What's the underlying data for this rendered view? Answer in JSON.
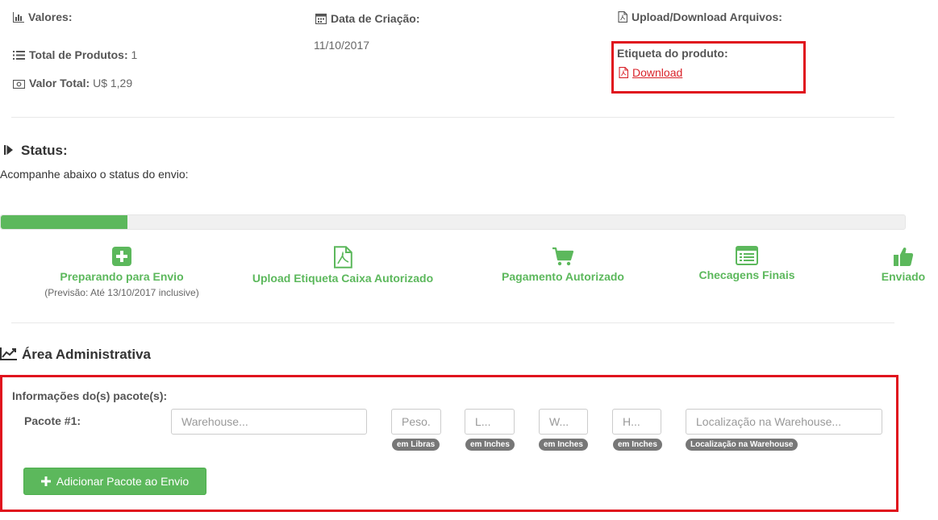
{
  "summary": {
    "values_label": "Valores:",
    "total_products_label": "Total de Produtos:",
    "total_products_value": "1",
    "total_value_label": "Valor Total:",
    "total_value_value": "U$ 1,29",
    "creation_date_label": "Data de Criação:",
    "creation_date_value": "11/10/2017",
    "upload_download_label": "Upload/Download Arquivos:",
    "product_label_title": "Etiqueta do produto:",
    "download_link": "Download"
  },
  "status": {
    "title": "Status:",
    "description": "Acompanhe abaixo o status do envio:",
    "progress": 0.14,
    "color": "#5cb85c",
    "steps": [
      {
        "label": "Preparando para Envio",
        "sub": "(Previsão: Até 13/10/2017 inclusive)",
        "icon": "plus-square-icon"
      },
      {
        "label": "Upload Etiqueta Caixa Autorizado",
        "icon": "pdf-file-icon"
      },
      {
        "label": "Pagamento Autorizado",
        "icon": "cart-icon"
      },
      {
        "label": "Checagens Finais",
        "icon": "list-icon"
      },
      {
        "label": "Enviado",
        "icon": "thumbs-up-icon"
      }
    ]
  },
  "admin": {
    "title": "Área Administrativa",
    "packages_title": "Informações do(s) pacote(s):",
    "package_label": "Pacote #1:",
    "fields": {
      "warehouse_placeholder": "Warehouse...",
      "weight_placeholder": "Peso.",
      "length_placeholder": "L...",
      "width_placeholder": "W...",
      "height_placeholder": "H...",
      "location_placeholder": "Localização na Warehouse..."
    },
    "badges": {
      "weight": "em Libras",
      "length": "em Inches",
      "width": "em Inches",
      "height": "em Inches",
      "location": "Localização na Warehouse"
    },
    "add_button": "Adicionar Pacote ao Envio"
  },
  "colors": {
    "accent_green": "#5cb85c",
    "highlight_red": "#e0121d",
    "link_red": "#d9232a"
  }
}
